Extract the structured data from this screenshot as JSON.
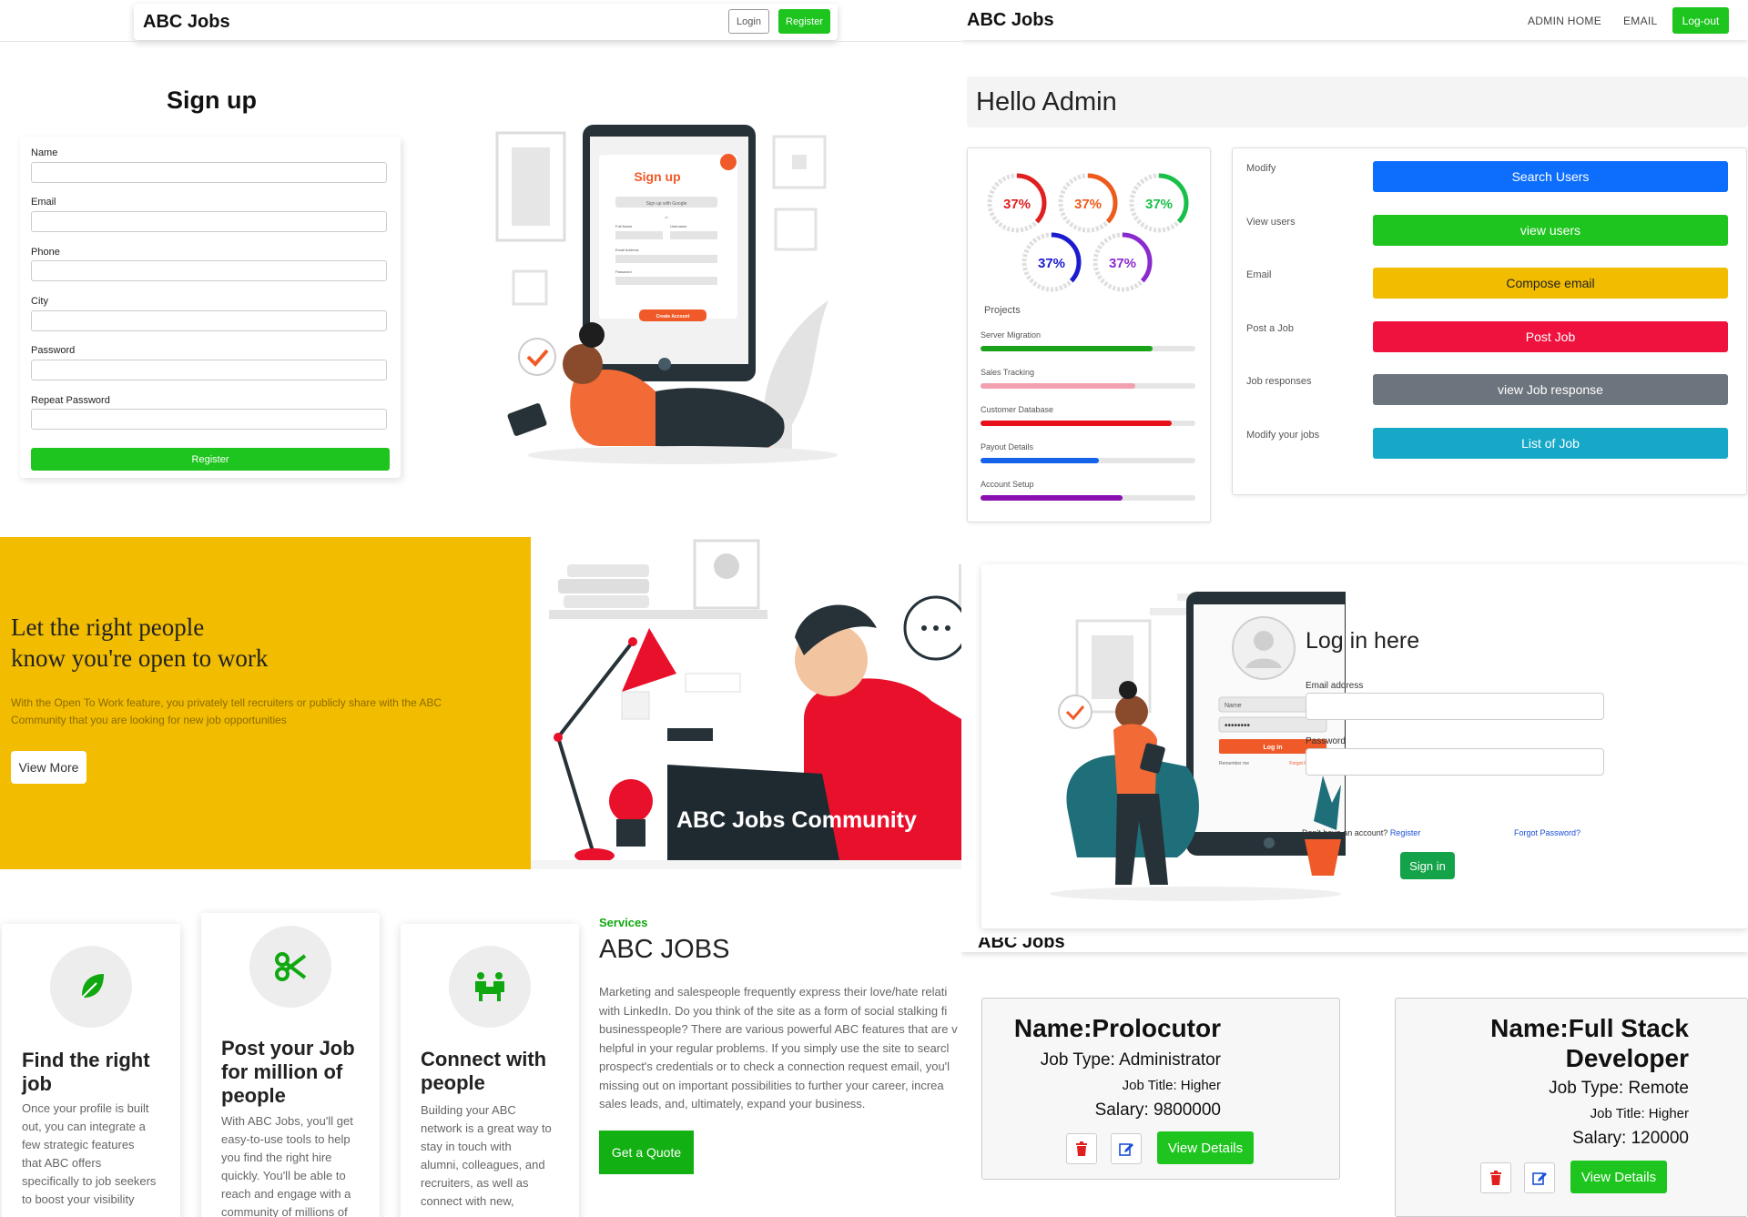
{
  "colors": {
    "green": "#1ec51e",
    "blue": "#0d6efd",
    "yellow": "#f2bc00",
    "red": "#f0123e",
    "gray": "#6c757d",
    "cyan": "#17a8c8",
    "purple": "#8a1fb0"
  },
  "signup": {
    "nav": {
      "brand": "ABC Jobs",
      "login": "Login",
      "register": "Register"
    },
    "title": "Sign up",
    "fields": {
      "name": "Name",
      "email": "Email",
      "phone": "Phone",
      "city": "City",
      "password": "Password",
      "repeat_password": "Repeat Password"
    },
    "submit": "Register",
    "illustration": {
      "title": "Sign up",
      "google": "Sign up with Google",
      "or": "or",
      "full_name": "Full Name",
      "username": "Username",
      "email_address": "Email Address",
      "password": "Password",
      "create": "Create Account"
    }
  },
  "admin": {
    "nav": {
      "brand": "ABC Jobs",
      "home": "ADMIN HOME",
      "email": "EMAIL",
      "logout": "Log-out"
    },
    "greeting": "Hello Admin",
    "rings": [
      {
        "label": "37%",
        "color": "#e01f1f"
      },
      {
        "label": "37%",
        "color": "#ee5a1c"
      },
      {
        "label": "37%",
        "color": "#18c04a"
      },
      {
        "label": "37%",
        "color": "#1b1bd0"
      },
      {
        "label": "37%",
        "color": "#8a2bd0"
      }
    ],
    "projects_title": "Projects",
    "projects": [
      {
        "label": "Server Migration",
        "value": 0.8,
        "color": "#1aa31a"
      },
      {
        "label": "Sales Tracking",
        "value": 0.72,
        "color": "#f2a0b0"
      },
      {
        "label": "Customer Database",
        "value": 0.89,
        "color": "#e8101a"
      },
      {
        "label": "Payout Details",
        "value": 0.55,
        "color": "#1463e8"
      },
      {
        "label": "Account Setup",
        "value": 0.66,
        "color": "#8a10b0"
      }
    ],
    "actions": [
      {
        "label": "Modify",
        "button": "Search Users",
        "color": "#0d6efd"
      },
      {
        "label": "View users",
        "button": "view users",
        "color": "#1ec51e"
      },
      {
        "label": "Email",
        "button": "Compose email",
        "color": "#f2bc00"
      },
      {
        "label": "Post a Job",
        "button": "Post Job",
        "color": "#f0123e"
      },
      {
        "label": "Job responses",
        "button": "view Job response",
        "color": "#6c757d"
      },
      {
        "label": "Modify your jobs",
        "button": "List of Job",
        "color": "#17a8c8"
      }
    ]
  },
  "hero": {
    "title_line1": "Let the right people",
    "title_line2": "know you're open to work",
    "desc_line1": "With the Open To Work feature, you privately tell recruiters or publicly share with the ABC",
    "desc_line2": "Community that you are looking for new job opportunities",
    "button": "View More",
    "community": "ABC Jobs Community"
  },
  "login": {
    "title": "Log in here",
    "email_label": "Email address",
    "password_label": "Password",
    "no_account": "Don't have an account?",
    "register": "Register",
    "forgot": "Forgot Password?",
    "signin": "Sign in",
    "illustration": {
      "name": "Name",
      "password_mask": "••••••••",
      "login": "Log in",
      "remember": "Remember me",
      "forgot": "Forgot Password?"
    }
  },
  "services": {
    "cards": [
      {
        "title_lines": [
          "Find the right",
          "job"
        ],
        "text_lines": [
          "Once your profile is built",
          "out, you can integrate a",
          "few strategic features",
          "that ABC offers",
          "specifically to job seekers",
          "to boost your visibility"
        ],
        "icon": "leaf-icon"
      },
      {
        "title_lines": [
          "Post your Job",
          "for million of",
          "people"
        ],
        "text_lines": [
          "With ABC Jobs, you'll get",
          "easy-to-use tools to help",
          "you find the right hire",
          "quickly. You'll be able to",
          "reach and engage with a",
          "community of millions of"
        ],
        "icon": "scissors-icon"
      },
      {
        "title_lines": [
          "Connect with",
          "people"
        ],
        "text_lines": [
          "Building your ABC",
          "network is a great way to",
          "stay in touch with",
          "alumni, colleagues, and",
          "recruiters, as well as",
          "connect with new,"
        ],
        "icon": "people-icon"
      }
    ],
    "kicker": "Services",
    "heading": "ABC JOBS",
    "body_lines": [
      "Marketing and salespeople frequently express their love/hate relati",
      "with LinkedIn. Do you think of the site as a form of social stalking fi",
      "businesspeople? There are various powerful ABC features that are v",
      "helpful in your regular problems. If you simply use the site to searcl",
      "prospect's credentials or to check a connection request email, you'l",
      "missing out on important possibilities to further your career, increa",
      "sales leads, and, ultimately, expand your business."
    ],
    "button": "Get a Quote"
  },
  "jobs": {
    "header_brand": "ABC Jobs",
    "cards": [
      {
        "name": "Name:Prolocutor",
        "type": "Job Type: Administrator",
        "title": "Job Title: Higher",
        "salary": "Salary: 9800000",
        "button": "View Details"
      },
      {
        "name_line1": "Name:Full Stack",
        "name_line2": "Developer",
        "type": "Job Type: Remote",
        "title": "Job Title: Higher",
        "salary": "Salary: 120000",
        "button": "View Details"
      }
    ]
  }
}
